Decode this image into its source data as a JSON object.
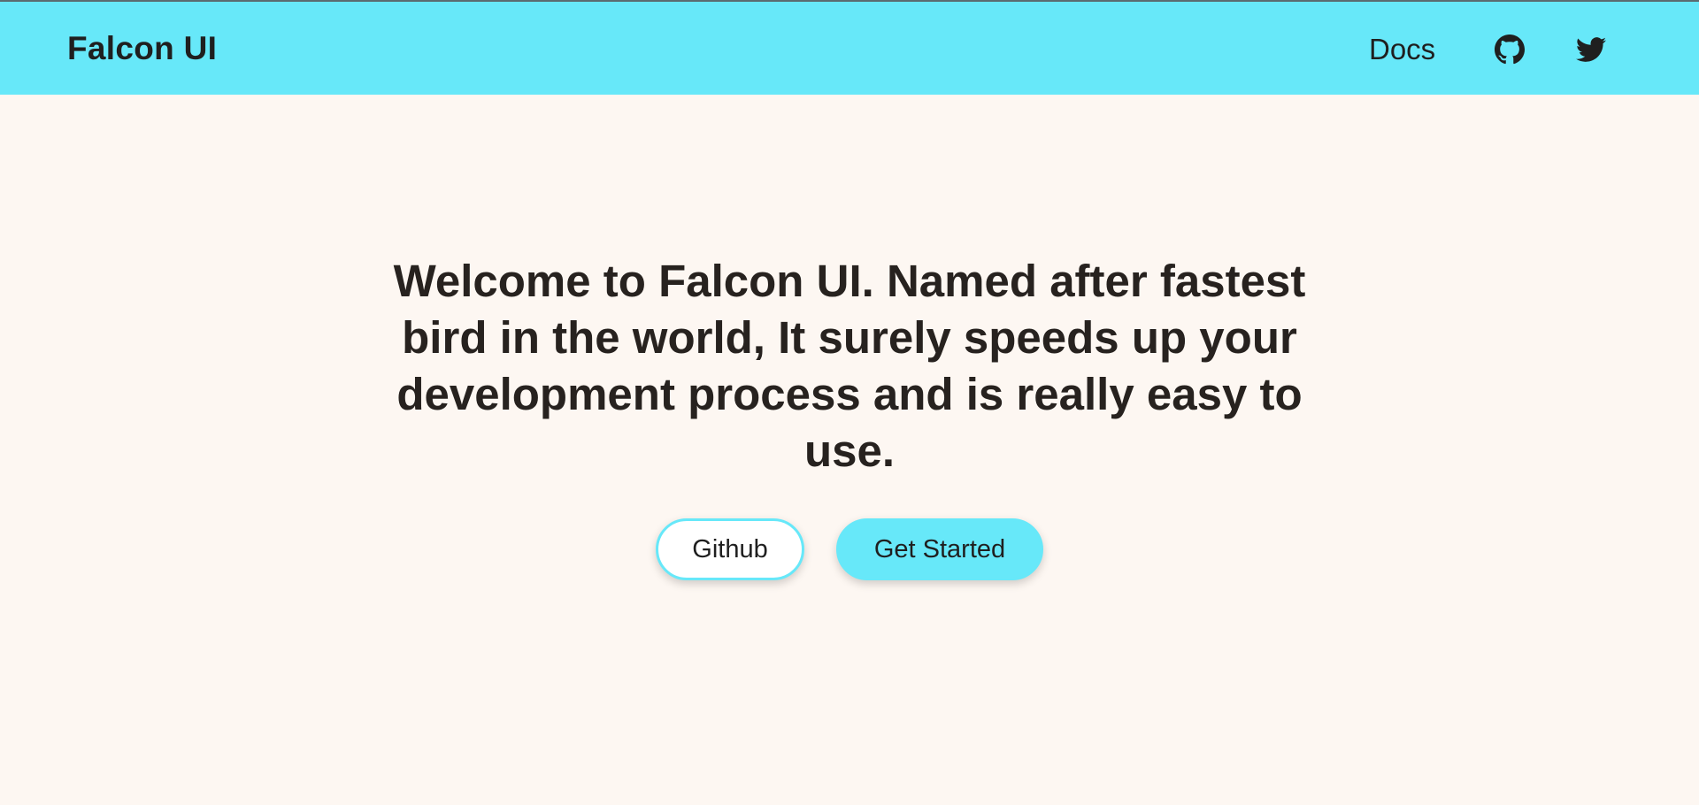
{
  "header": {
    "brand": "Falcon UI",
    "nav": {
      "docs_label": "Docs",
      "github_icon": "github-icon",
      "twitter_icon": "twitter-icon"
    },
    "background_color": "#67e8f9"
  },
  "hero": {
    "title": "Welcome to Falcon UI. Named after fastest bird in the world, It surely speeds up your development process and is really easy to use.",
    "buttons": {
      "github_label": "Github",
      "get_started_label": "Get Started"
    }
  },
  "colors": {
    "accent": "#67e8f9",
    "page_background": "#fdf7f2",
    "text": "#27221f"
  }
}
